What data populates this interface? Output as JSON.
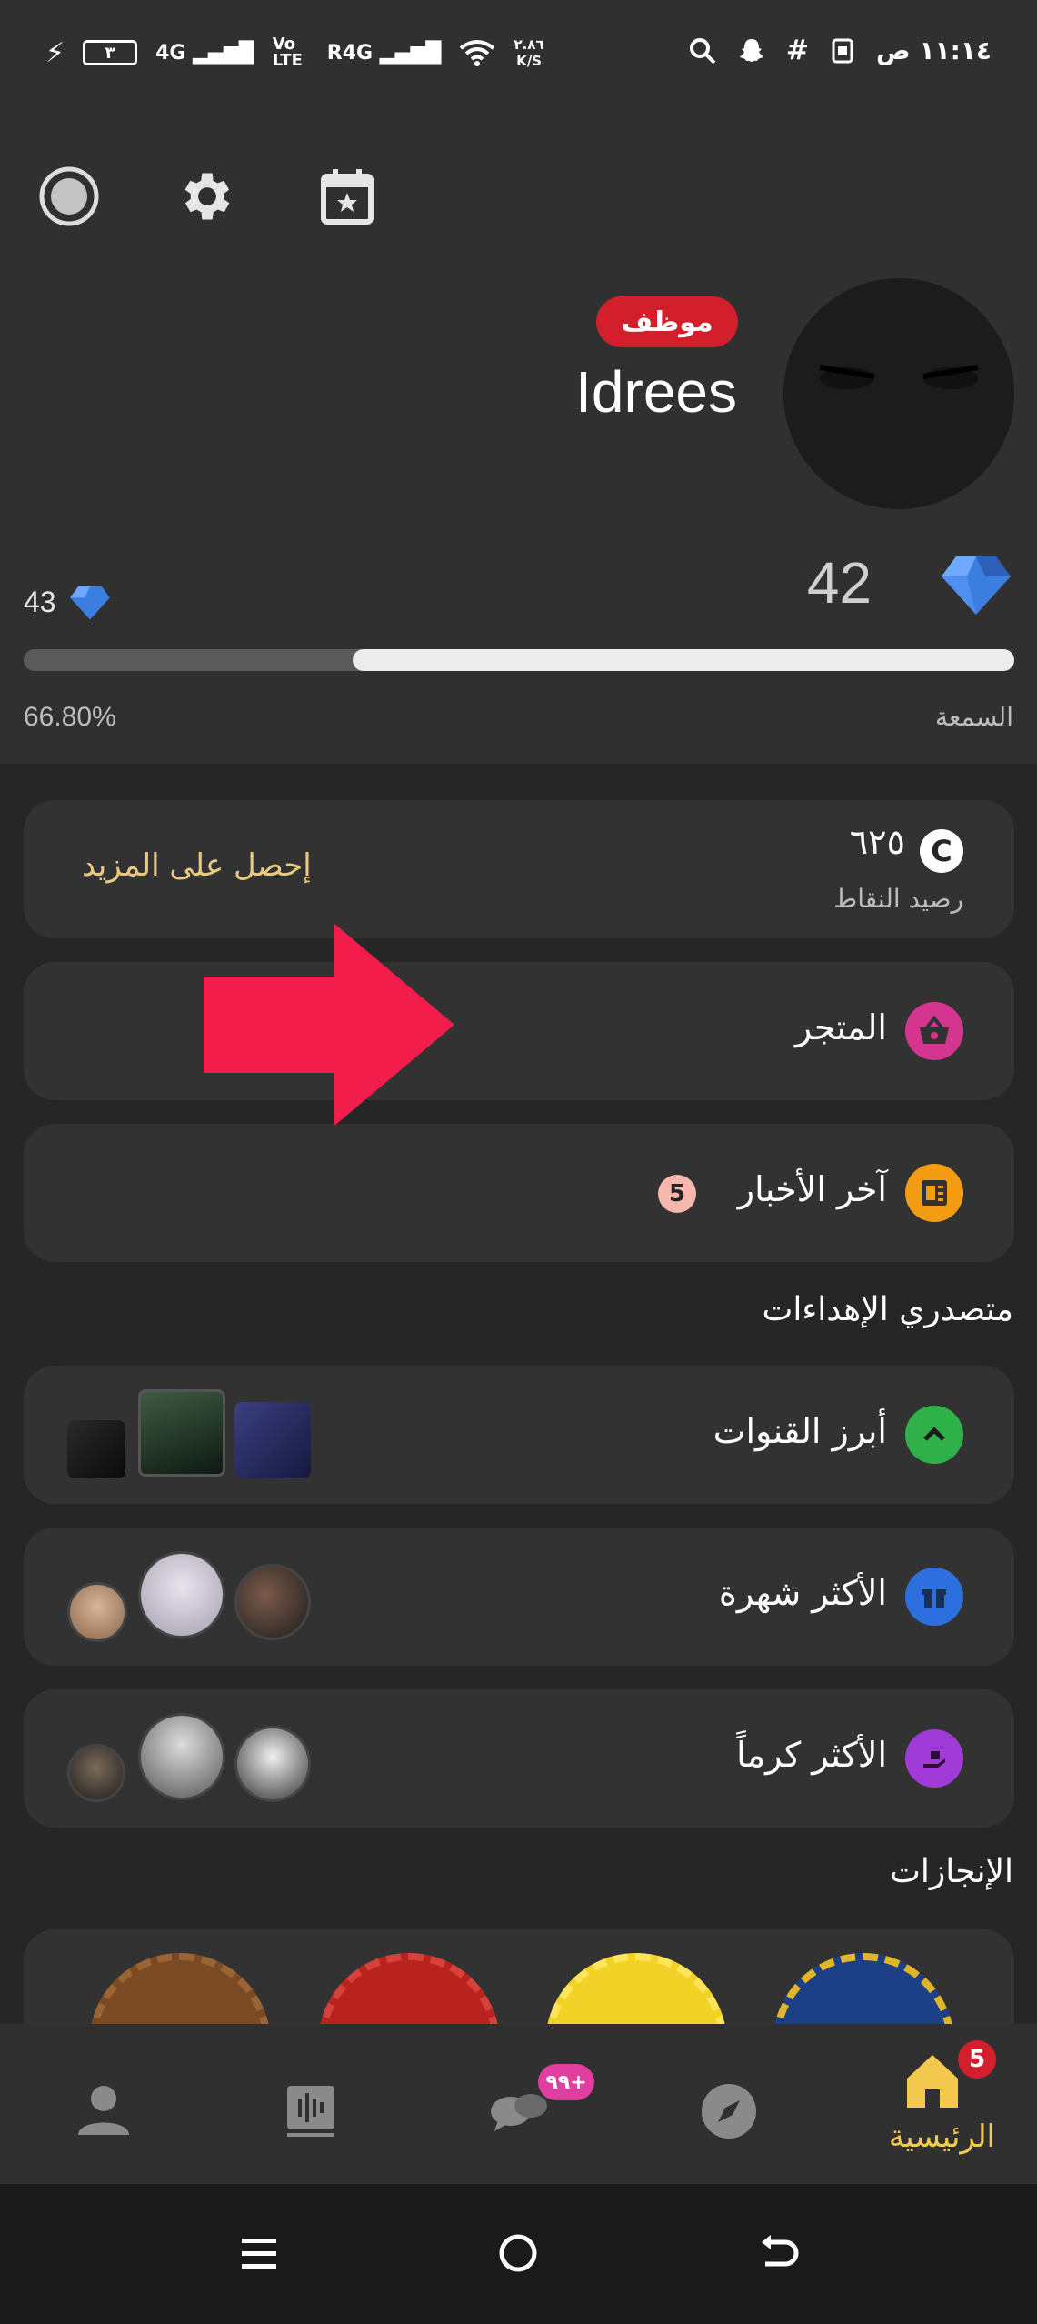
{
  "status_bar": {
    "time": "١١:١٤ ص",
    "battery": "٣",
    "net_speed_value": "٢.٨٦",
    "net_speed_unit": "K/S",
    "net_labels": [
      "4G",
      "Vo LTE",
      "R4G"
    ]
  },
  "header": {
    "username": "Idrees",
    "role_badge": "موظف",
    "role_badge_color": "#d21f2b",
    "current_level": "42",
    "next_level": "43",
    "progress_percent_label": "66.80%",
    "progress_fraction": 0.668,
    "reputation_label": "السمعة"
  },
  "points": {
    "value": "٦٢٥",
    "currency_icon_letter": "C",
    "label": "رصيد النقاط",
    "get_more": "إحصل على المزيد",
    "get_more_color": "#e8c982"
  },
  "menu": {
    "store": "المتجر",
    "store_icon_color": "#d4358f",
    "news": "آخر الأخبار",
    "news_badge": "5",
    "news_icon_color": "#f39c11"
  },
  "gifts": {
    "section_title": "متصدري الإهداءات",
    "top_channels": "أبرز القنوات",
    "most_famous": "الأكثر شهرة",
    "most_generous": "الأكثر كرماً"
  },
  "achievements": {
    "section_title": "الإنجازات"
  },
  "bottom_nav": {
    "home_label": "الرئيسية",
    "home_badge": "5",
    "chat_badge": "٩٩+",
    "accent_color": "#f2c94c"
  }
}
